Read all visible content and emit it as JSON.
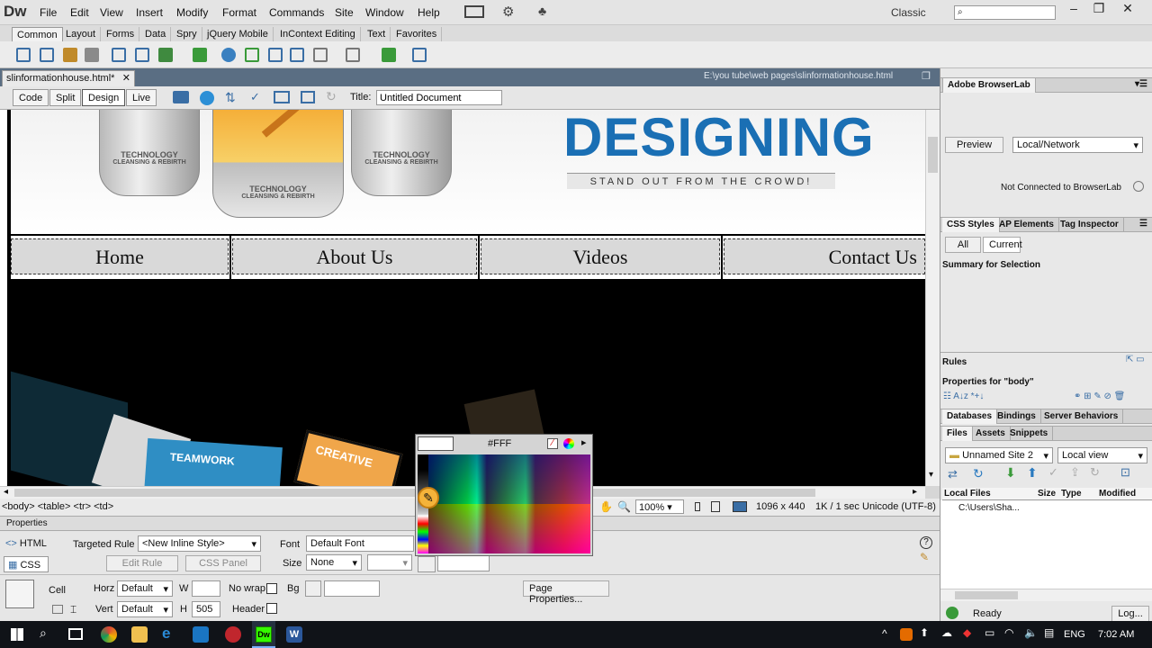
{
  "app": {
    "logo": "Dw",
    "workspace": "Classic"
  },
  "menu": [
    "File",
    "Edit",
    "View",
    "Insert",
    "Modify",
    "Format",
    "Commands",
    "Site",
    "Window",
    "Help"
  ],
  "insert_tabs": [
    "Common",
    "Layout",
    "Forms",
    "Data",
    "Spry",
    "jQuery Mobile",
    "InContext Editing",
    "Text",
    "Favorites"
  ],
  "document": {
    "tab_label": "slinformationhouse.html*",
    "path": "E:\\you tube\\web pages\\slinformationhouse.html",
    "views": [
      "Code",
      "Split",
      "Design",
      "Live"
    ],
    "title_label": "Title:",
    "title_value": "Untitled Document"
  },
  "page": {
    "banner_heading": "DESIGNING",
    "banner_tagline": "STAND OUT FROM THE CROWD!",
    "glass_label": "TECHNOLOGY",
    "glass_sub": "CLEANSING & REBIRTH",
    "nav": [
      "Home",
      "About Us",
      "Videos",
      "Contact Us"
    ],
    "hero_labels": [
      "TEAMWORK",
      "CREATIVE"
    ]
  },
  "status": {
    "tag_path": "<body> <table> <tr> <td>",
    "zoom": "100%",
    "dimensions": "1096 x 440",
    "filesize": "1K / 1 sec",
    "encoding": "Unicode (UTF-8)"
  },
  "properties": {
    "header": "Properties",
    "html_btn": "HTML",
    "css_btn": "CSS",
    "targeted_rule_label": "Targeted Rule",
    "targeted_rule_value": "<New Inline Style>",
    "edit_rule": "Edit Rule",
    "css_panel": "CSS Panel",
    "font_label": "Font",
    "font_value": "Default Font",
    "size_label": "Size",
    "size_value": "None",
    "cell_label": "Cell",
    "horz_label": "Horz",
    "horz_value": "Default",
    "vert_label": "Vert",
    "vert_value": "Default",
    "w_label": "W",
    "w_value": "",
    "h_label": "H",
    "h_value": "505",
    "nowrap_label": "No wrap",
    "header_label": "Header",
    "bg_label": "Bg",
    "page_properties": "Page Properties..."
  },
  "color_picker": {
    "hex": "#FFF"
  },
  "right_panel": {
    "browserlab_title": "Adobe BrowserLab",
    "preview_btn": "Preview",
    "local_network": "Local/Network",
    "not_connected": "Not Connected to BrowserLab",
    "css_tabs": [
      "CSS Styles",
      "AP Elements",
      "Tag Inspector"
    ],
    "all_btn": "All",
    "current_btn": "Current",
    "summary": "Summary for Selection",
    "rules": "Rules",
    "props_for": "Properties for \"body\"",
    "db_tabs": [
      "Databases",
      "Bindings",
      "Server Behaviors"
    ],
    "files_tabs": [
      "Files",
      "Assets",
      "Snippets"
    ],
    "site_select": "Unnamed Site 2",
    "view_select": "Local view",
    "file_cols": [
      "Local Files",
      "Size",
      "Type",
      "Modified"
    ],
    "file_row": "C:\\Users\\Sha...",
    "ready": "Ready",
    "log_btn": "Log..."
  },
  "taskbar": {
    "lang": "ENG",
    "time": "7:02 AM"
  },
  "colors": {
    "accent_blue": "#1a6fb4",
    "doctab_bar": "#5a6e83",
    "taskbar": "#101318"
  }
}
